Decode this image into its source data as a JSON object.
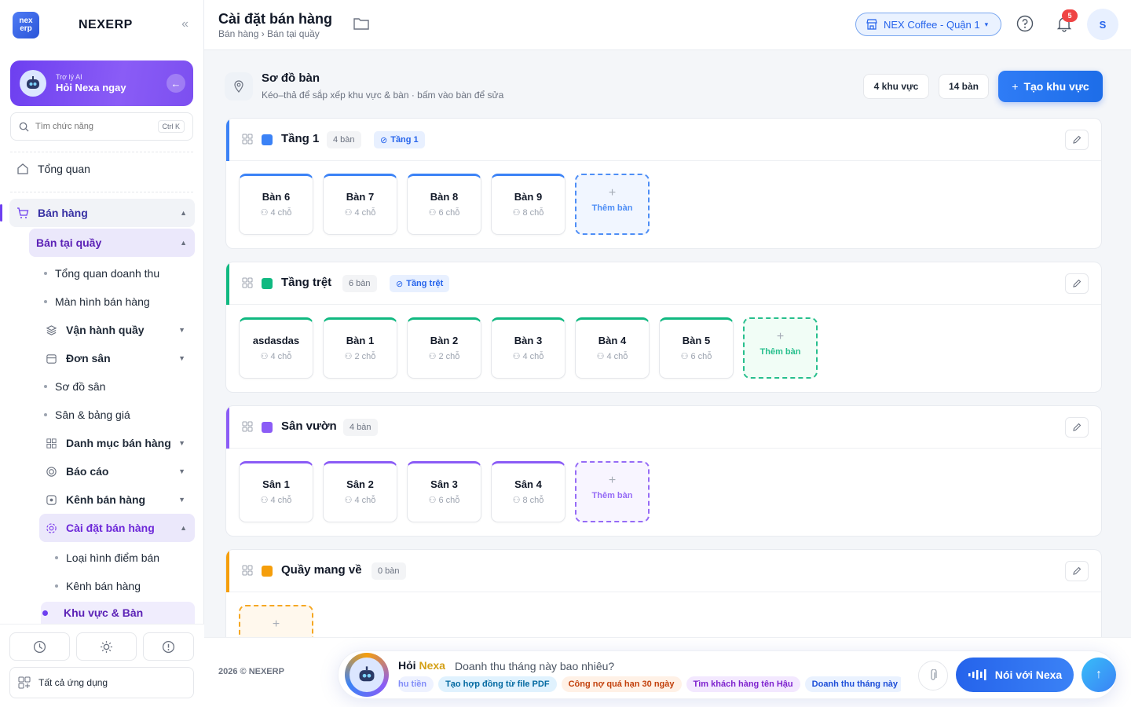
{
  "app": {
    "logo_text": "nex erp",
    "brand": "NEXERP"
  },
  "ai_card": {
    "small": "Trợ lý AI",
    "big": "Hỏi Nexa ngay"
  },
  "search": {
    "placeholder": "Tìm chức năng",
    "shortcut": "Ctrl K"
  },
  "sidebar": {
    "overview": "Tổng quan",
    "sales": "Bán hàng",
    "pos": "Bán tại quầy",
    "items": [
      "Tổng quan doanh thu",
      "Màn hình bán hàng",
      "Vận hành quầy",
      "Đơn sân",
      "Sơ đồ sân",
      "Sân & bảng giá",
      "Danh mục bán hàng",
      "Báo cáo",
      "Kênh bán hàng",
      "Cài đặt bán hàng",
      "Loại hình điểm bán",
      "Kênh bán hàng",
      "Khu vực & Bàn"
    ],
    "all_apps": "Tất cả ứng dụng"
  },
  "header": {
    "title": "Cài đặt bán hàng",
    "breadcrumb": "Bán hàng › Bán tại quầy",
    "branch": "NEX Coffee - Quận 1",
    "notif_count": "5",
    "avatar": "S"
  },
  "page": {
    "title": "Sơ đồ bàn",
    "subtitle": "Kéo–thả để sắp xếp khu vực & bàn · bấm vào bàn để sửa",
    "zones_stat": "4 khu vực",
    "tables_stat": "14 bàn",
    "create_btn": "Tạo khu vực",
    "add_table": "Thêm bàn"
  },
  "zones": [
    {
      "name": "Tầng 1",
      "count": "4 bàn",
      "tag": "Tầng 1",
      "color": "#3b82f6",
      "tables": [
        {
          "name": "Bàn 6",
          "seats": "4 chỗ"
        },
        {
          "name": "Bàn 7",
          "seats": "4 chỗ"
        },
        {
          "name": "Bàn 8",
          "seats": "6 chỗ"
        },
        {
          "name": "Bàn 9",
          "seats": "8 chỗ"
        }
      ]
    },
    {
      "name": "Tầng trệt",
      "count": "6 bàn",
      "tag": "Tầng trệt",
      "color": "#10b981",
      "tables": [
        {
          "name": "asdasdas",
          "seats": "4 chỗ"
        },
        {
          "name": "Bàn 1",
          "seats": "2 chỗ"
        },
        {
          "name": "Bàn 2",
          "seats": "2 chỗ"
        },
        {
          "name": "Bàn 3",
          "seats": "4 chỗ"
        },
        {
          "name": "Bàn 4",
          "seats": "4 chỗ"
        },
        {
          "name": "Bàn 5",
          "seats": "6 chỗ"
        }
      ]
    },
    {
      "name": "Sân vườn",
      "count": "4 bàn",
      "tag": "",
      "color": "#8b5cf6",
      "tables": [
        {
          "name": "Sân 1",
          "seats": "4 chỗ"
        },
        {
          "name": "Sân 2",
          "seats": "4 chỗ"
        },
        {
          "name": "Sân 3",
          "seats": "6 chỗ"
        },
        {
          "name": "Sân 4",
          "seats": "8 chỗ"
        }
      ]
    },
    {
      "name": "Quầy mang về",
      "count": "0 bàn",
      "tag": "",
      "color": "#f59e0b",
      "tables": []
    }
  ],
  "footer": {
    "copyright": "2026 © NEXERP",
    "ask_prefix": "Hỏi ",
    "ask_brand": "Nexa",
    "question": "Doanh thu tháng này bao nhiêu?",
    "chips": [
      "hu tiền",
      "Tạo hợp đồng từ file PDF",
      "Công nợ quá hạn 30 ngày",
      "Tìm khách hàng tên Hậu",
      "Doanh thu tháng này"
    ],
    "talk_btn": "Nói với Nexa"
  }
}
